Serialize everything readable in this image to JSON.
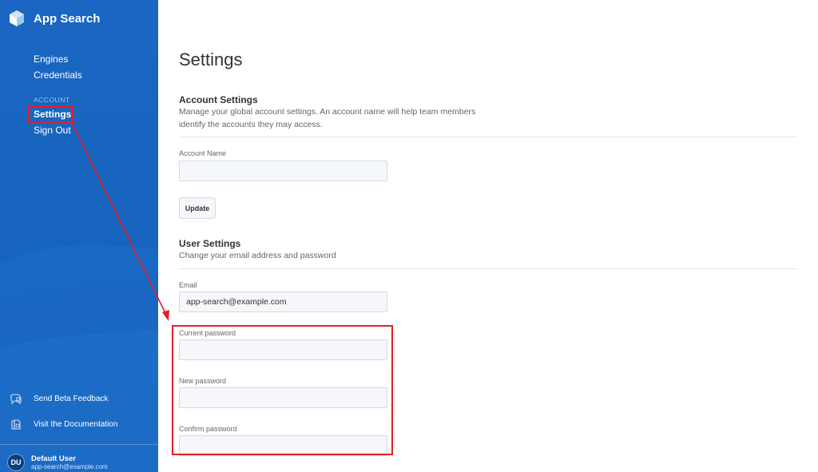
{
  "brand": {
    "name": "App Search"
  },
  "nav": {
    "items": [
      {
        "label": "Engines"
      },
      {
        "label": "Credentials"
      }
    ],
    "section_label": "ACCOUNT",
    "account_items": [
      {
        "label": "Settings",
        "active": true
      },
      {
        "label": "Sign Out"
      }
    ]
  },
  "side_links": [
    {
      "label": "Send Beta Feedback",
      "icon": "chat-bubble-icon"
    },
    {
      "label": "Visit the Documentation",
      "icon": "documentation-icon"
    }
  ],
  "user": {
    "initials": "DU",
    "name": "Default User",
    "email": "app-search@example.com"
  },
  "page": {
    "title": "Settings"
  },
  "account_settings": {
    "title": "Account Settings",
    "description": "Manage your global account settings. An account name will help team members identify the accounts they may access.",
    "account_name_label": "Account Name",
    "account_name_value": "",
    "update_button": "Update"
  },
  "user_settings": {
    "title": "User Settings",
    "description": "Change your email address and password",
    "email_label": "Email",
    "email_value": "app-search@example.com",
    "current_password_label": "Current password",
    "new_password_label": "New password",
    "confirm_password_label": "Confirm password"
  },
  "colors": {
    "sidebar": "#1764be",
    "annotation": "#e41e26",
    "input_bg": "#f5f7fa"
  }
}
